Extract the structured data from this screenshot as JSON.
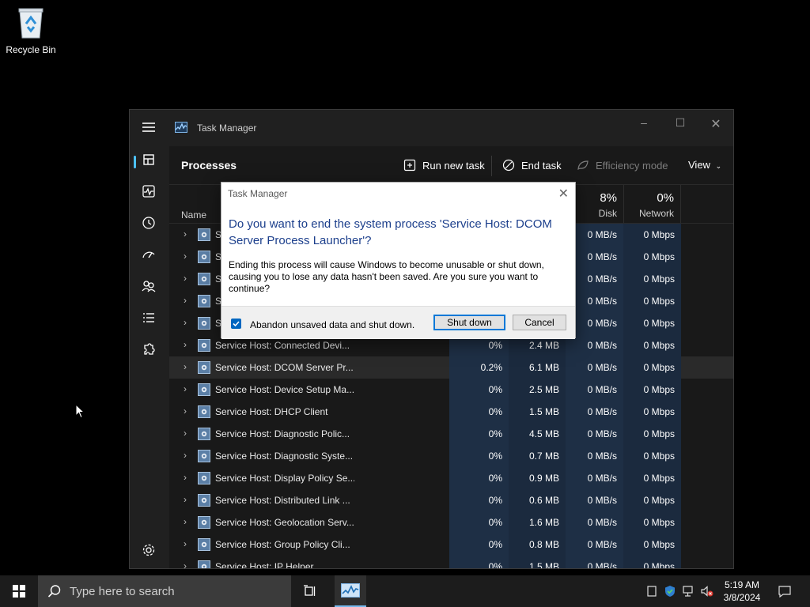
{
  "desktop": {
    "recycle_bin_label": "Recycle Bin"
  },
  "window": {
    "title": "Task Manager",
    "page_title": "Processes",
    "toolbar": {
      "run_new_task": "Run new task",
      "end_task": "End task",
      "efficiency_mode": "Efficiency mode",
      "view": "View"
    },
    "columns": {
      "name": "Name",
      "disk_pct": "8%",
      "disk": "Disk",
      "network_pct": "0%",
      "network": "Network"
    },
    "rows": [
      {
        "name": "S",
        "cpu": "",
        "mem": "",
        "disk": "0 MB/s",
        "net": "0 Mbps"
      },
      {
        "name": "S",
        "cpu": "",
        "mem": "",
        "disk": "0 MB/s",
        "net": "0 Mbps"
      },
      {
        "name": "S",
        "cpu": "",
        "mem": "",
        "disk": "0 MB/s",
        "net": "0 Mbps"
      },
      {
        "name": "S",
        "cpu": "",
        "mem": "",
        "disk": "0 MB/s",
        "net": "0 Mbps"
      },
      {
        "name": "S",
        "cpu": "",
        "mem": "",
        "disk": "0 MB/s",
        "net": "0 Mbps"
      },
      {
        "name": "Service Host: Connected Devi...",
        "cpu": "0%",
        "mem": "2.4 MB",
        "disk": "0 MB/s",
        "net": "0 Mbps"
      },
      {
        "name": "Service Host: DCOM Server Pr...",
        "cpu": "0.2%",
        "mem": "6.1 MB",
        "disk": "0 MB/s",
        "net": "0 Mbps"
      },
      {
        "name": "Service Host: Device Setup Ma...",
        "cpu": "0%",
        "mem": "2.5 MB",
        "disk": "0 MB/s",
        "net": "0 Mbps"
      },
      {
        "name": "Service Host: DHCP Client",
        "cpu": "0%",
        "mem": "1.5 MB",
        "disk": "0 MB/s",
        "net": "0 Mbps"
      },
      {
        "name": "Service Host: Diagnostic Polic...",
        "cpu": "0%",
        "mem": "4.5 MB",
        "disk": "0 MB/s",
        "net": "0 Mbps"
      },
      {
        "name": "Service Host: Diagnostic Syste...",
        "cpu": "0%",
        "mem": "0.7 MB",
        "disk": "0 MB/s",
        "net": "0 Mbps"
      },
      {
        "name": "Service Host: Display Policy Se...",
        "cpu": "0%",
        "mem": "0.9 MB",
        "disk": "0 MB/s",
        "net": "0 Mbps"
      },
      {
        "name": "Service Host: Distributed Link ...",
        "cpu": "0%",
        "mem": "0.6 MB",
        "disk": "0 MB/s",
        "net": "0 Mbps"
      },
      {
        "name": "Service Host: Geolocation Serv...",
        "cpu": "0%",
        "mem": "1.6 MB",
        "disk": "0 MB/s",
        "net": "0 Mbps"
      },
      {
        "name": "Service Host: Group Policy Cli...",
        "cpu": "0%",
        "mem": "0.8 MB",
        "disk": "0 MB/s",
        "net": "0 Mbps"
      },
      {
        "name": "Service Host: IP Helper",
        "cpu": "0%",
        "mem": "1.5 MB",
        "disk": "0 MB/s",
        "net": "0 Mbps"
      }
    ]
  },
  "dialog": {
    "title": "Task Manager",
    "question": "Do you want to end the system process 'Service Host: DCOM Server Process Launcher'?",
    "message": "Ending this process will cause Windows to become unusable or shut down, causing you to lose any data hasn't been saved. Are you sure you want to continue?",
    "checkbox_label": "Abandon unsaved data and shut down.",
    "checkbox_checked": true,
    "shutdown_label": "Shut down",
    "cancel_label": "Cancel"
  },
  "taskbar": {
    "search_placeholder": "Type here to search",
    "time": "5:19 AM",
    "date": "3/8/2024"
  },
  "colors": {
    "accent": "#4cc2ff",
    "dialog_heading": "#1c3f8c",
    "checkbox": "#0067c0"
  }
}
